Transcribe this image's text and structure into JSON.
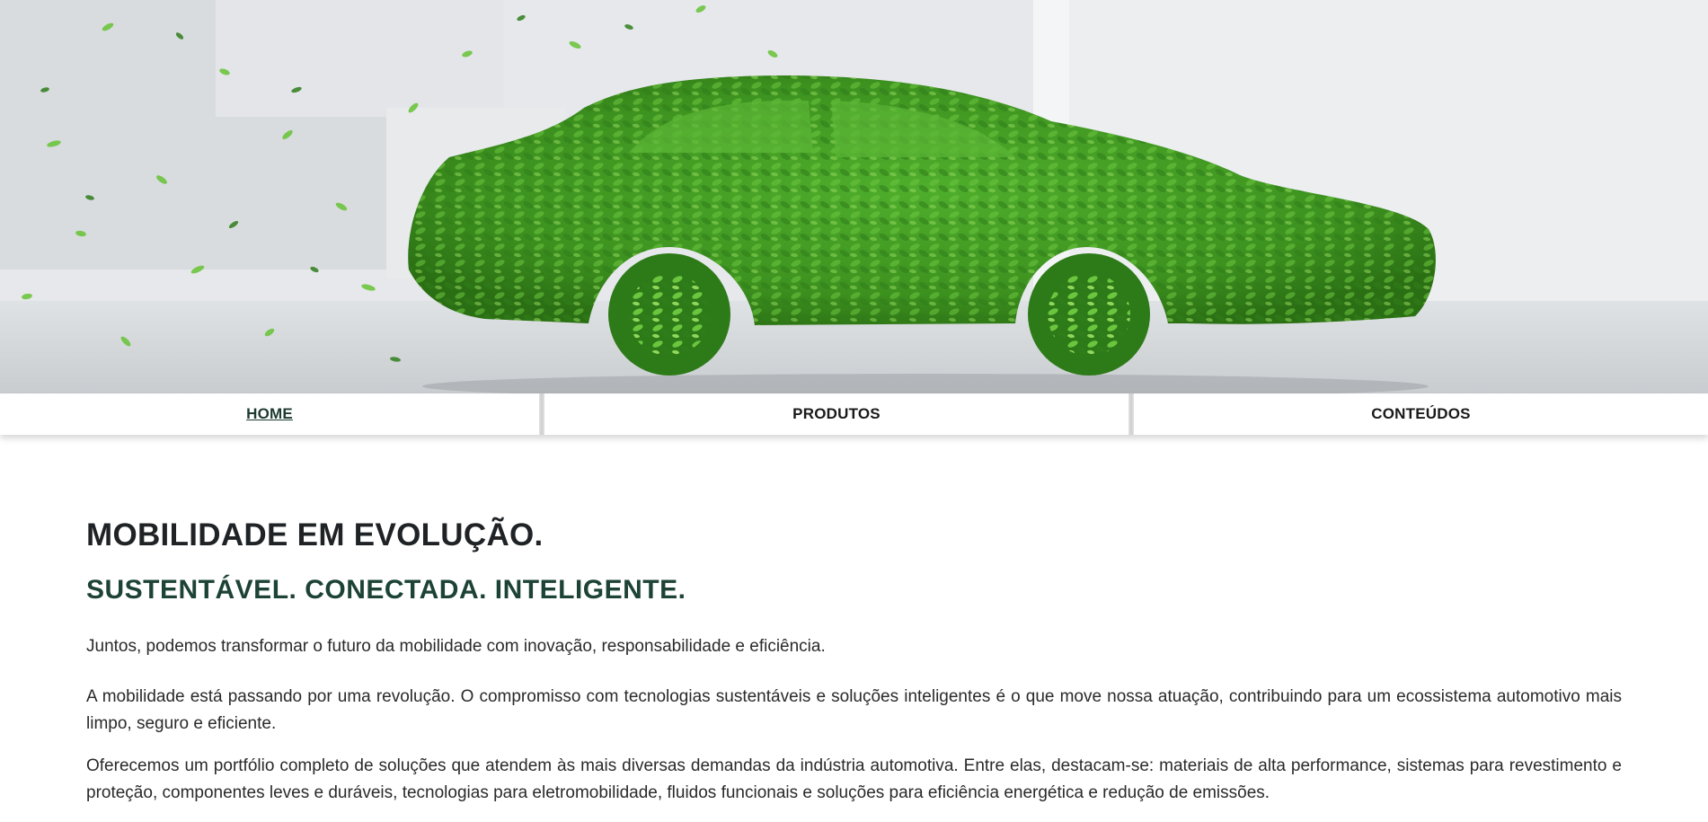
{
  "hero": {
    "image_name": "green-leaf-car-banner",
    "colors": {
      "leaf_dark": "#2f7d1a",
      "leaf_mid": "#47a52a",
      "leaf_light": "#7cc94a",
      "background": "#e9ebee"
    }
  },
  "nav": {
    "items": [
      {
        "label": "HOME",
        "active": true
      },
      {
        "label": "PRODUTOS",
        "active": false
      },
      {
        "label": "CONTEÚDOS",
        "active": false
      }
    ]
  },
  "main": {
    "title": "MOBILIDADE EM EVOLUÇÃO.",
    "subtitle": "SUSTENTÁVEL. CONECTADA. INTELIGENTE.",
    "lead": "Juntos, podemos transformar o futuro da mobilidade com inovação, responsabilidade e eficiência.",
    "paragraphs": [
      "A mobilidade está passando por uma revolução. O compromisso com tecnologias sustentáveis e soluções inteligentes é o que move nossa atuação, contribuindo para um ecossistema automotivo mais limpo, seguro e eficiente.",
      "Oferecemos um portfólio completo de soluções que atendem às mais diversas demandas da indústria automotiva. Entre elas, destacam-se: materiais de alta performance, sistemas para revestimento e proteção, componentes leves e duráveis, tecnologias para eletromobilidade, fluidos funcionais e soluções para eficiência energética e redução de emissões."
    ]
  },
  "colors": {
    "heading": "#1f2326",
    "accent_green": "#1d4336",
    "text": "#2a2a2a"
  }
}
